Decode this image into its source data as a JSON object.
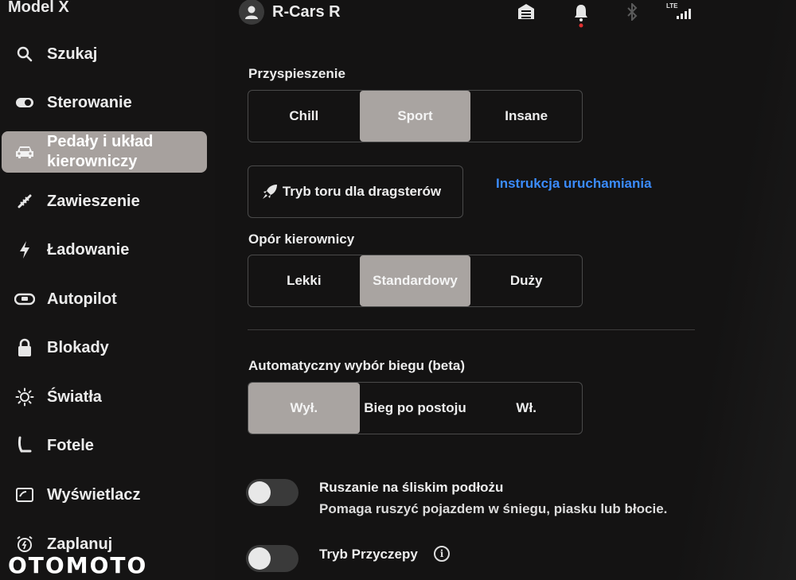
{
  "sidebar": {
    "model": "Model X",
    "items": [
      {
        "label": "Szukaj",
        "icon": "search-icon"
      },
      {
        "label": "Sterowanie",
        "icon": "toggle-icon"
      },
      {
        "label": "Pedały i układ kierowniczy",
        "icon": "car-icon",
        "active": true
      },
      {
        "label": "Zawieszenie",
        "icon": "suspension-icon"
      },
      {
        "label": "Ładowanie",
        "icon": "lightning-icon"
      },
      {
        "label": "Autopilot",
        "icon": "steering-wheel-icon"
      },
      {
        "label": "Blokady",
        "icon": "lock-icon"
      },
      {
        "label": "Światła",
        "icon": "sun-icon"
      },
      {
        "label": "Fotele",
        "icon": "seat-icon"
      },
      {
        "label": "Wyświetlacz",
        "icon": "display-icon"
      },
      {
        "label": "Zaplanuj",
        "icon": "alarm-clock-icon"
      }
    ]
  },
  "topbar": {
    "user": "R-Cars R",
    "lte_label": "LTE",
    "icons": [
      "garage-icon",
      "bell-icon",
      "bluetooth-icon",
      "signal-icon"
    ]
  },
  "acceleration": {
    "title": "Przyspieszenie",
    "options": [
      "Chill",
      "Sport",
      "Insane"
    ],
    "selected": "Sport"
  },
  "drag_strip": {
    "label": "Tryb toru dla dragsterów",
    "link": "Instrukcja uruchamiania"
  },
  "steering": {
    "title": "Opór kierownicy",
    "options": [
      "Lekki",
      "Standardowy",
      "Duży"
    ],
    "selected": "Standardowy"
  },
  "auto_shift": {
    "title": "Automatyczny wybór biegu (beta)",
    "options": [
      "Wył.",
      "Bieg po postoju",
      "Wł."
    ],
    "selected": "Wył."
  },
  "slip_start": {
    "title": "Ruszanie na śliskim podłożu",
    "description": "Pomaga ruszyć pojazdem w śniegu, piasku lub błocie.",
    "enabled": false
  },
  "trailer": {
    "title": "Tryb Przyczepy",
    "enabled": false
  },
  "watermark": "OTOMOTO",
  "colors": {
    "accent_link": "#3b8cff",
    "selected_segment": "#a9a4a1",
    "active_nav": "#a7a19e",
    "notification_dot": "#e03030"
  }
}
